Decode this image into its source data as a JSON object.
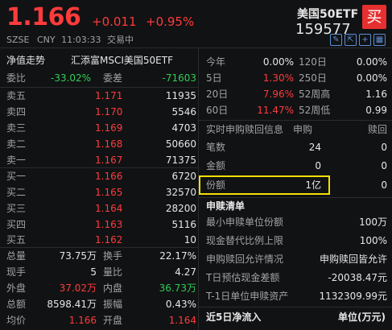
{
  "header": {
    "price": "1.166",
    "change": "+0.011",
    "change_pct": "+0.95%",
    "name": "美国50ETF",
    "code": "159577",
    "buy_label": "买",
    "exchange": "SZSE",
    "currency": "CNY",
    "time": "11:03:33",
    "status": "交易中"
  },
  "left": {
    "net_value_label": "净值走势",
    "fund_name": "汇添富MSCI美国50ETF",
    "weibi_label": "委比",
    "weibi_value": "-33.02%",
    "weicha_label": "委差",
    "weicha_value": "-71603",
    "sell": [
      {
        "label": "卖五",
        "price": "1.171",
        "vol": "11935"
      },
      {
        "label": "卖四",
        "price": "1.170",
        "vol": "5546"
      },
      {
        "label": "卖三",
        "price": "1.169",
        "vol": "4703"
      },
      {
        "label": "卖二",
        "price": "1.168",
        "vol": "50660"
      },
      {
        "label": "卖一",
        "price": "1.167",
        "vol": "71375"
      }
    ],
    "buy": [
      {
        "label": "买一",
        "price": "1.166",
        "vol": "6720"
      },
      {
        "label": "买二",
        "price": "1.165",
        "vol": "32570"
      },
      {
        "label": "买三",
        "price": "1.164",
        "vol": "28200"
      },
      {
        "label": "买四",
        "price": "1.163",
        "vol": "5116"
      },
      {
        "label": "买五",
        "price": "1.162",
        "vol": "10"
      }
    ],
    "stats": [
      {
        "l1": "总量",
        "v1": "73.75万",
        "l2": "换手",
        "v2": "22.17%"
      },
      {
        "l1": "现手",
        "v1": "5",
        "l2": "量比",
        "v2": "4.27"
      },
      {
        "l1": "外盘",
        "v1": "37.02万",
        "l2": "内盘",
        "v2": "36.73万"
      },
      {
        "l1": "总额",
        "v1": "8598.41万",
        "l2": "振幅",
        "v2": "0.43%"
      },
      {
        "l1": "均价",
        "v1": "1.166",
        "l2": "开盘",
        "v2": "1.164"
      }
    ]
  },
  "right": {
    "perf": [
      {
        "l1": "今年",
        "v1": "0.00%",
        "l2": "120日",
        "v2": "0.00%"
      },
      {
        "l1": "5日",
        "v1": "1.30%",
        "l2": "250日",
        "v2": "0.00%"
      },
      {
        "l1": "20日",
        "v1": "7.96%",
        "l2": "52周高",
        "v2": "1.16"
      },
      {
        "l1": "60日",
        "v1": "11.47%",
        "l2": "52周低",
        "v2": "0.99"
      }
    ],
    "realtime_title": "实时申购赎回信息",
    "realtime_col1": "申购",
    "realtime_col2": "赎回",
    "realtime_rows": [
      {
        "label": "笔数",
        "sub": "24",
        "red": "0"
      },
      {
        "label": "金额",
        "sub": "0",
        "red": "0"
      },
      {
        "label": "份额",
        "sub": "1亿",
        "red": "0"
      }
    ],
    "list_title": "申赎清单",
    "list_rows": [
      {
        "label": "最小申赎单位份额",
        "value": "100万"
      },
      {
        "label": "现金替代比例上限",
        "value": "100%"
      },
      {
        "label": "申购赎回允许情况",
        "value": "申购赎回皆允许"
      },
      {
        "label": "T日预估现金差额",
        "value": "-20038.47元"
      },
      {
        "label": "T-1日单位申赎资产",
        "value": "1132309.99元"
      }
    ],
    "footer_title": "近5日净流入",
    "footer_unit": "单位(万元)"
  },
  "colors": {
    "red": "#ff3b3b",
    "green": "#2fcf52",
    "highlight": "#f3e000",
    "accent": "#e62f2f"
  }
}
